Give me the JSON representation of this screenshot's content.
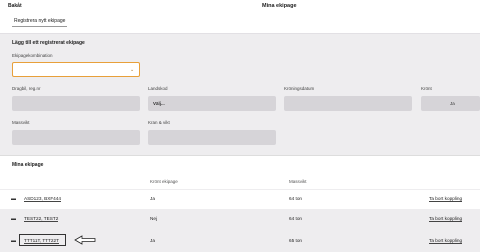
{
  "header": {
    "back_label": "Bakåt",
    "title": "Mina ekipage"
  },
  "register_button": "Registrera nytt ekipage",
  "form": {
    "title": "Lägg till ett registrerat ekipage",
    "combo_label": "Ekipagekombination",
    "combo_value": "",
    "fields": {
      "dragbil_label": "Dragbil, reg.nr",
      "landskod_label": "Landskod",
      "landskod_value": "Välj...",
      "kronning_label": "Kröningsdatum",
      "kront_label": "Krönt",
      "kront_value": "Ja",
      "massvikt_label": "Massvikt",
      "kran_label": "Kran & vikt"
    }
  },
  "section": {
    "title": "Mina ekipage"
  },
  "table": {
    "headers": {
      "kront": "Krönt ekipage",
      "massvikt": "Massvikt"
    },
    "rows": [
      {
        "name": "ASD123, BXF444",
        "kront": "Ja",
        "massvikt": "64 ton",
        "action": "Ta bort koppling"
      },
      {
        "name": "TEST22, TEST2",
        "kront": "Nej",
        "massvikt": "64 ton",
        "action": "Ta bort koppling"
      },
      {
        "name": "TTT11T, TTT22T",
        "kront": "Ja",
        "massvikt": "65 ton",
        "action": "Ta bort koppling"
      }
    ]
  }
}
